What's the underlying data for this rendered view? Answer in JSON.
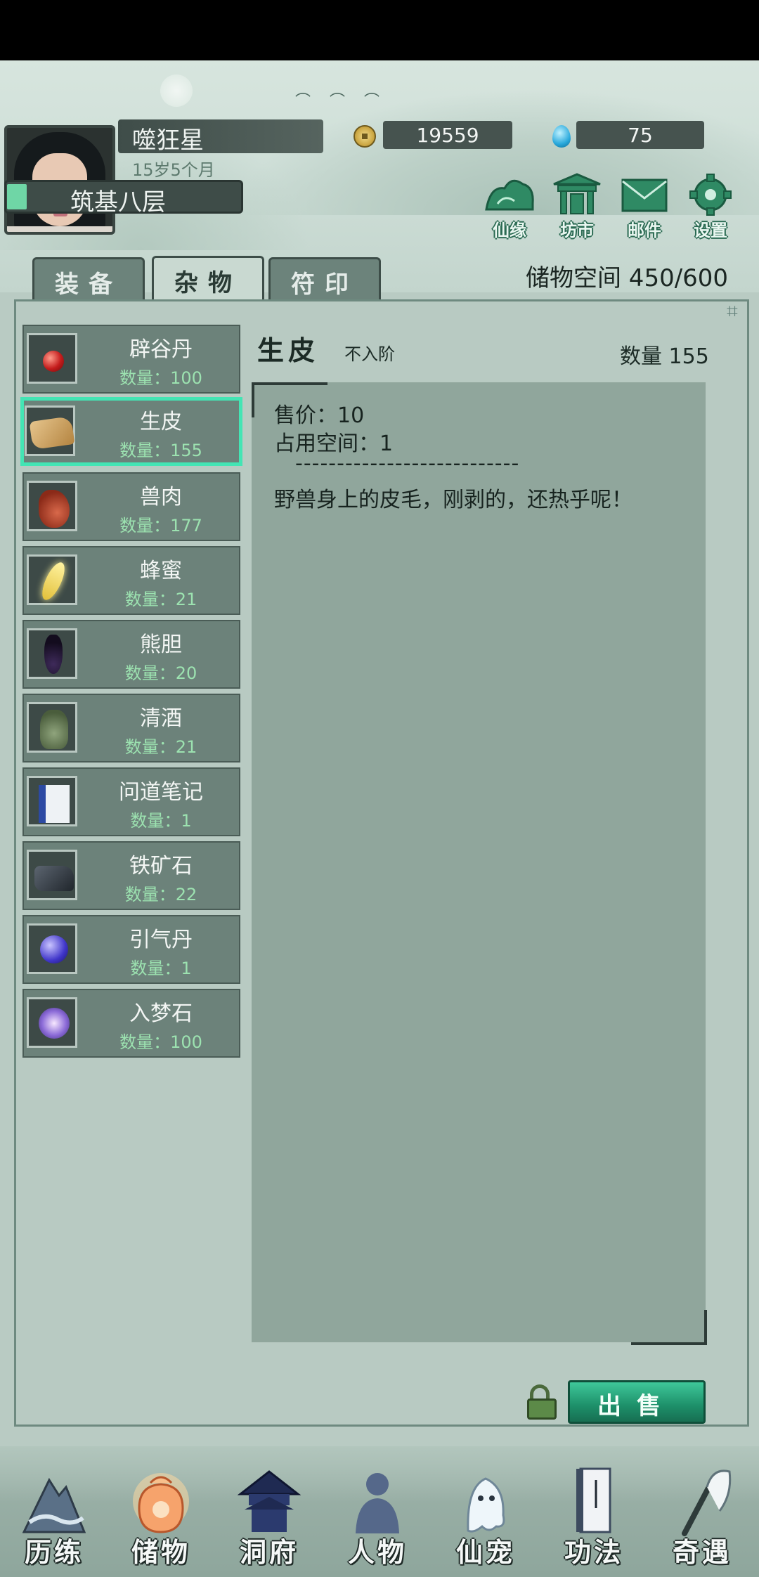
{
  "player": {
    "name": "噬狂星",
    "age": "15岁5个月",
    "realm": "筑基八层",
    "coins": "19559",
    "gems": "75"
  },
  "top_buttons": [
    {
      "label": "仙缘",
      "icon": "fate-icon"
    },
    {
      "label": "坊市",
      "icon": "market-icon"
    },
    {
      "label": "邮件",
      "icon": "mail-icon"
    },
    {
      "label": "设置",
      "icon": "gear-icon"
    }
  ],
  "tabs": [
    {
      "label": "装备",
      "active": false
    },
    {
      "label": "杂物",
      "active": true
    },
    {
      "label": "符印",
      "active": false
    }
  ],
  "storage": "储物空间 450/600",
  "items": [
    {
      "name": "辟谷丹",
      "qty": "数量：100",
      "icon": "pill-icon",
      "selected": false
    },
    {
      "name": "生皮",
      "qty": "数量：155",
      "icon": "hide-icon",
      "selected": true
    },
    {
      "name": "兽肉",
      "qty": "数量：177",
      "icon": "meat-icon",
      "selected": false
    },
    {
      "name": "蜂蜜",
      "qty": "数量：21",
      "icon": "honey-icon",
      "selected": false
    },
    {
      "name": "熊胆",
      "qty": "数量：20",
      "icon": "bear-bile-icon",
      "selected": false
    },
    {
      "name": "清酒",
      "qty": "数量：21",
      "icon": "wine-jar-icon",
      "selected": false
    },
    {
      "name": "问道笔记",
      "qty": "数量：1",
      "icon": "notebook-icon",
      "selected": false
    },
    {
      "name": "铁矿石",
      "qty": "数量：22",
      "icon": "iron-ore-icon",
      "selected": false
    },
    {
      "name": "引气丹",
      "qty": "数量：1",
      "icon": "qi-pill-icon",
      "selected": false
    },
    {
      "name": "入梦石",
      "qty": "数量：100",
      "icon": "dream-stone-icon",
      "selected": false
    }
  ],
  "detail": {
    "name": "生皮",
    "grade": "不入阶",
    "qty": "数量 155",
    "price": "售价：10",
    "space": "占用空间：1",
    "divider": "---------------------------",
    "description": "野兽身上的皮毛，刚剥的，还热乎呢！"
  },
  "sell_button": "出售",
  "nav": [
    {
      "label": "历练",
      "icon": "mountain-icon"
    },
    {
      "label": "储物",
      "icon": "pouch-icon"
    },
    {
      "label": "洞府",
      "icon": "pavilion-icon"
    },
    {
      "label": "人物",
      "icon": "person-icon"
    },
    {
      "label": "仙宠",
      "icon": "ghost-pet-icon"
    },
    {
      "label": "功法",
      "icon": "scroll-book-icon"
    },
    {
      "label": "奇遇",
      "icon": "brush-icon"
    }
  ]
}
